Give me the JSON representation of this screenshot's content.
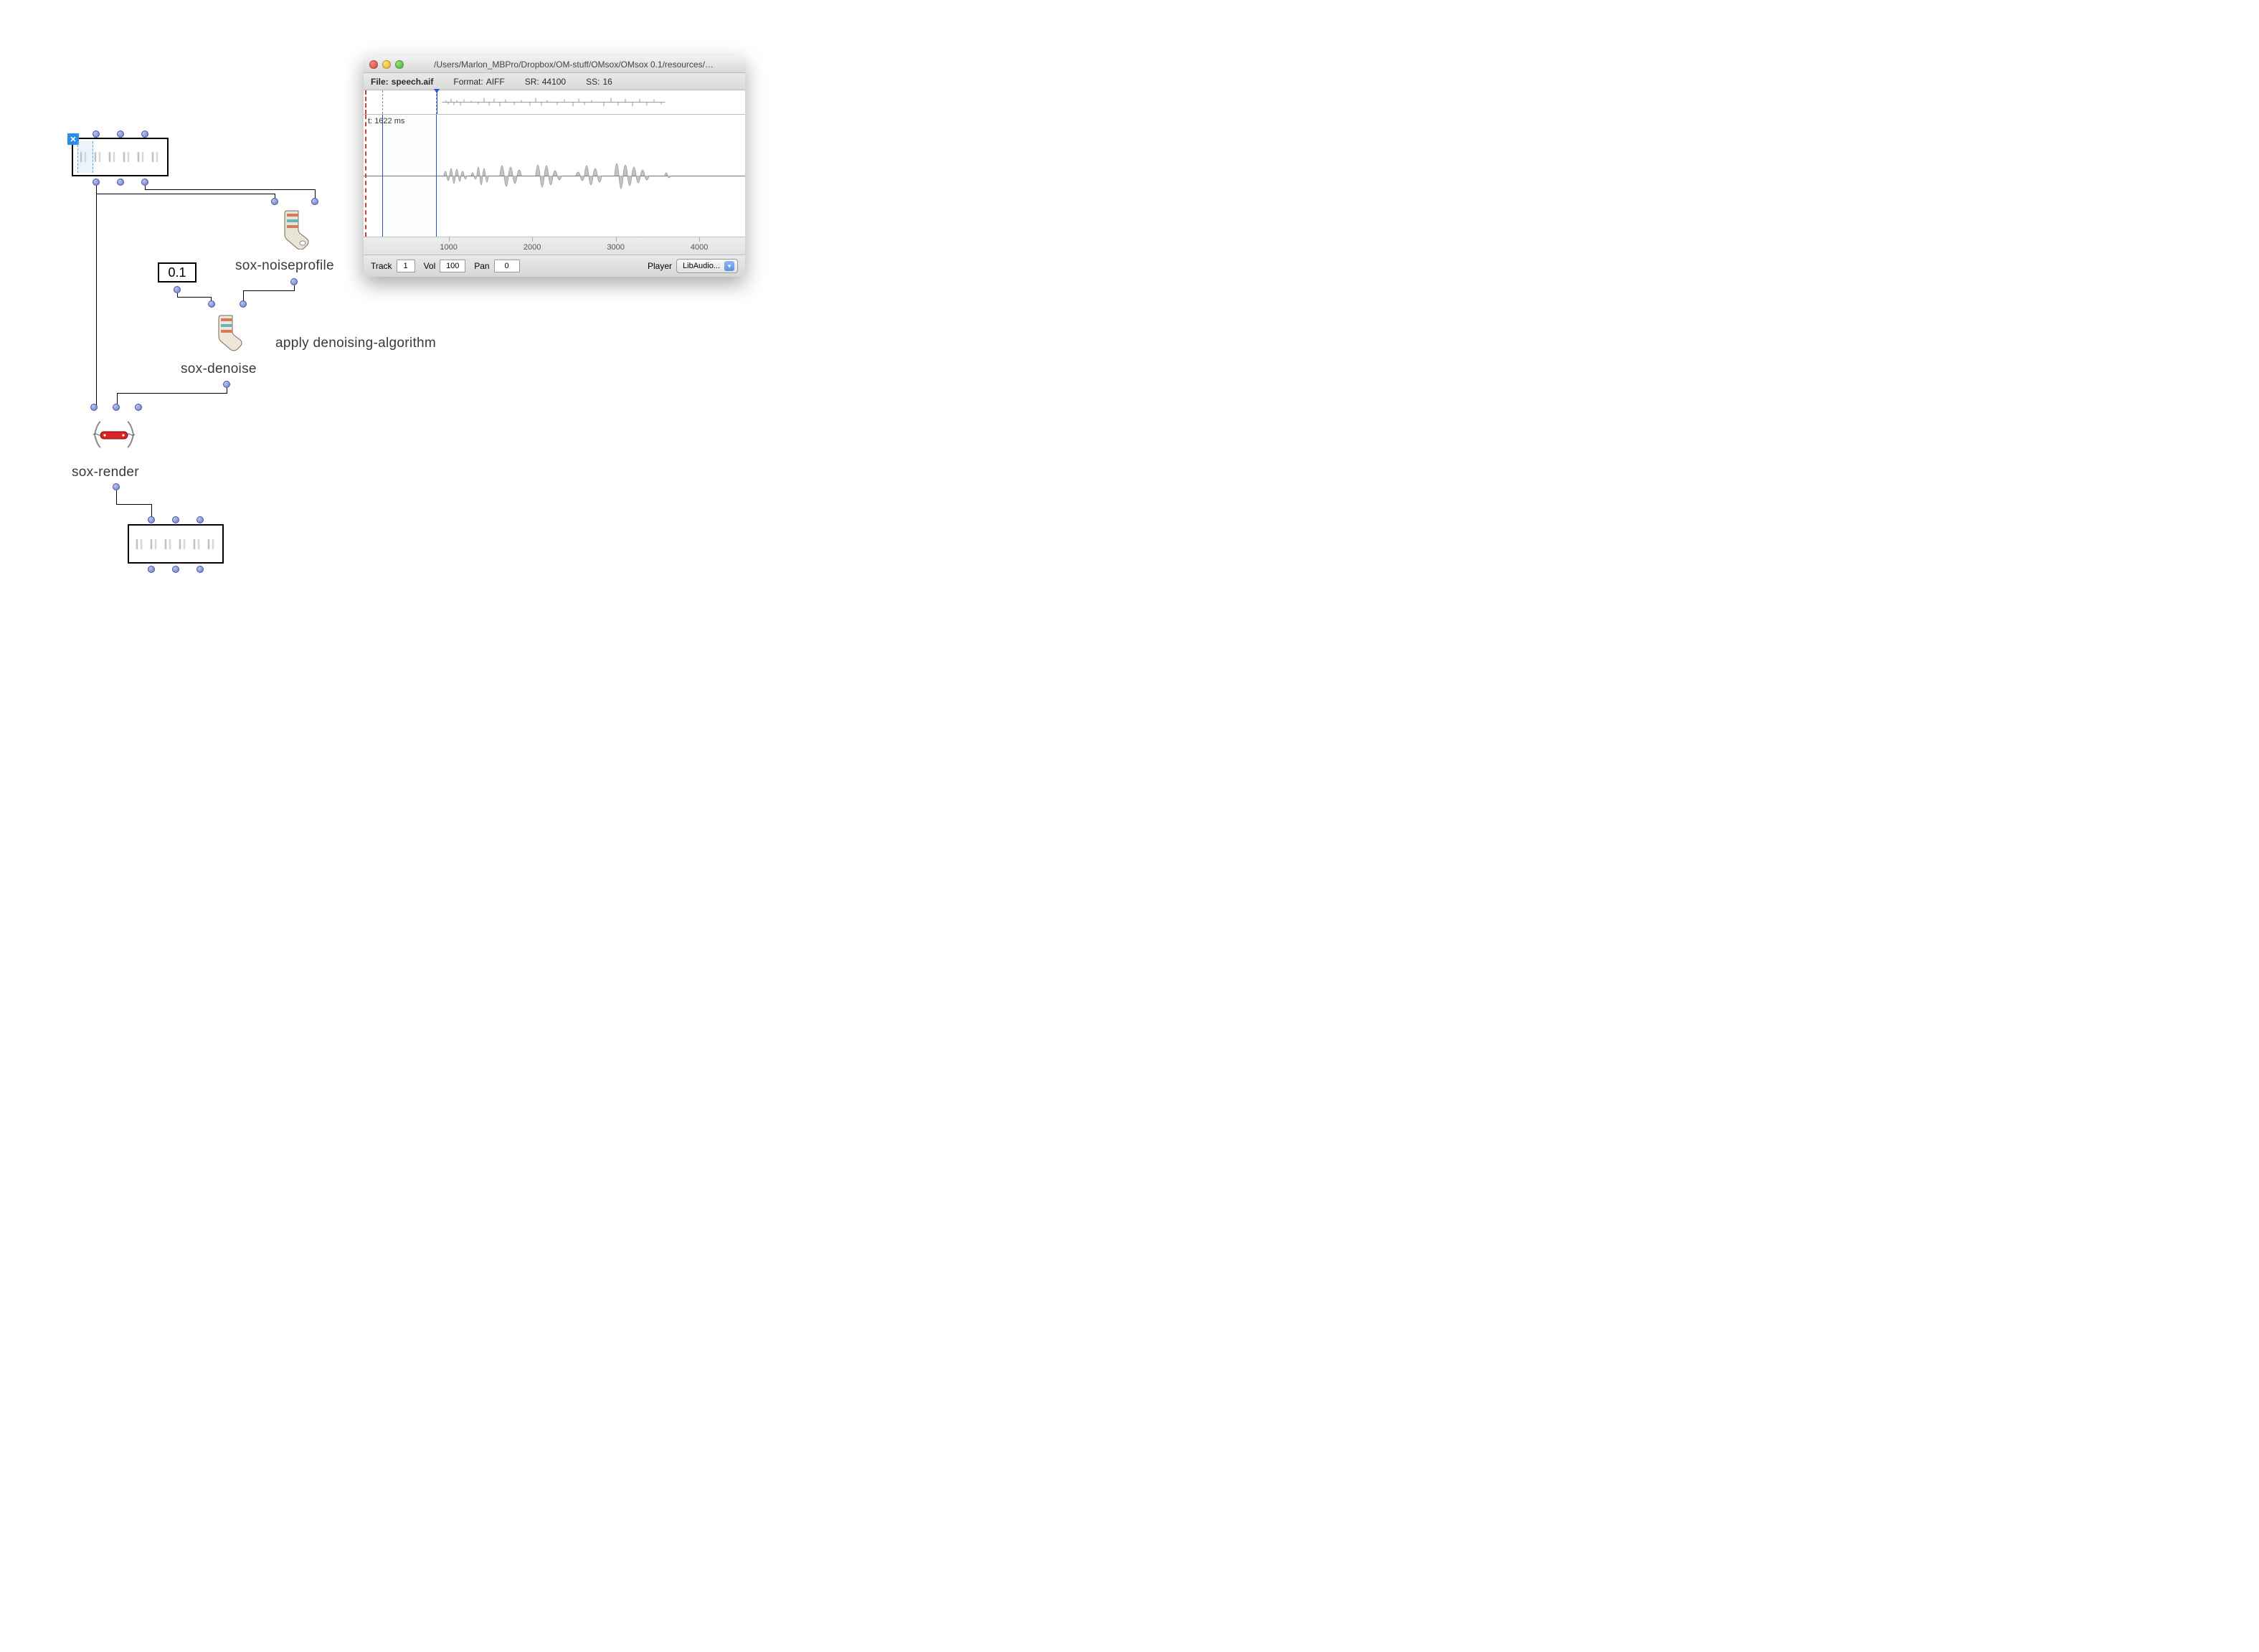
{
  "patch": {
    "sound_in_selection": true,
    "number_box_value": "0.1",
    "node_labels": {
      "noiseprofile": "sox-noiseprofile",
      "denoise": "sox-denoise",
      "render": "sox-render"
    },
    "annotation": "apply denoising-algorithm"
  },
  "editor": {
    "title": "/Users/Marlon_MBPro/Dropbox/OM-stuff/OMsox/OMsox 0.1/resources/…",
    "file_label": "File:",
    "file_name": "speech.aif",
    "format_label": "Format:",
    "format_value": "AIFF",
    "sr_label": "SR:",
    "sr_value": "44100",
    "ss_label": "SS:",
    "ss_value": "16",
    "cursor_label": "t:",
    "cursor_ms": "1622 ms",
    "ruler_ticks": [
      "1000",
      "2000",
      "3000",
      "4000"
    ],
    "transport": {
      "track_label": "Track",
      "track_value": "1",
      "vol_label": "Vol",
      "vol_value": "100",
      "pan_label": "Pan",
      "pan_value": "0",
      "player_label": "Player",
      "player_value": "LibAudio..."
    }
  }
}
